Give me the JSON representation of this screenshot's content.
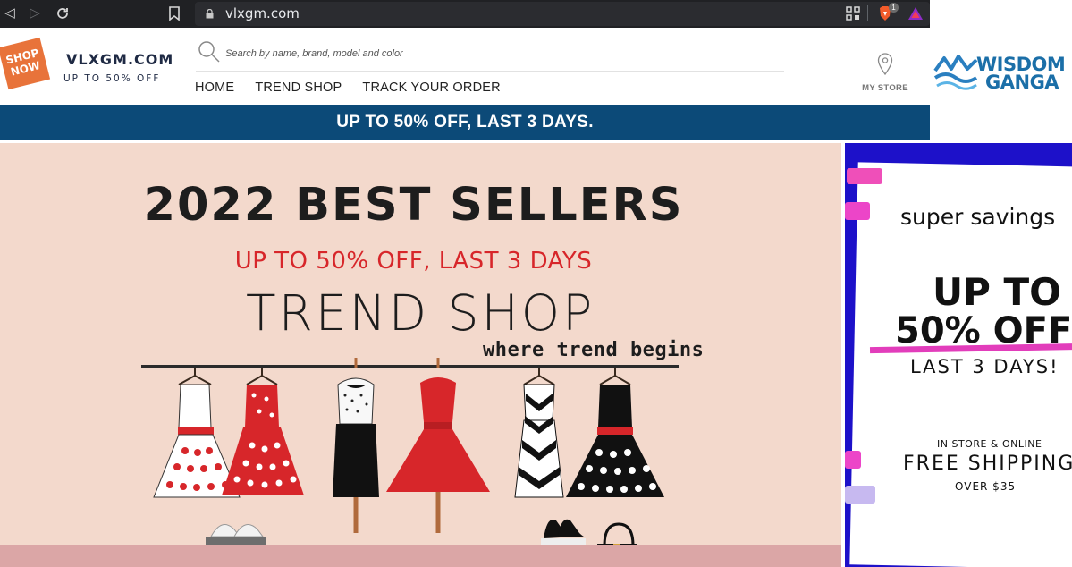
{
  "browser": {
    "url": "vlxgm.com",
    "shield_badge_count": "1",
    "icons": [
      "back-icon",
      "forward-icon",
      "reload-icon",
      "bookmark-icon",
      "lock-icon",
      "qr-icon",
      "brave-shield-icon",
      "brave-rewards-icon"
    ]
  },
  "header": {
    "shop_now_line1": "SHOP",
    "shop_now_line2": "NOW",
    "logo_title": "VLXGM.COM",
    "logo_subtitle": "UP TO 50% OFF",
    "search_placeholder": "Search by name, brand, model and color",
    "nav": [
      "HOME",
      "TREND SHOP",
      "TRACK YOUR ORDER"
    ],
    "my_store_label": "MY STORE"
  },
  "promo_bar": {
    "text": "UP TO 50% OFF, LAST 3 DAYS."
  },
  "watermark": {
    "line1": "WISDOM",
    "line2": "GANGA"
  },
  "hero": {
    "title": "2022 BEST SELLERS",
    "subtitle": "UP TO 50% OFF, LAST 3 DAYS",
    "shop_name": "TREND SHOP",
    "tagline": "where trend begins"
  },
  "side_ad": {
    "line1": "super savings",
    "line2": "UP TO",
    "line3": "50% OFF",
    "line4": "LAST 3 DAYS!",
    "line5": "IN STORE & ONLINE",
    "line6": "FREE SHIPPING",
    "line7": "OVER $35"
  },
  "colors": {
    "chrome": "#202124",
    "promo_bar": "#0c4a78",
    "hero_bg": "#f3d9cc",
    "accent_red": "#d7262a",
    "shop_now": "#e8733a",
    "side_ad_blue": "#1d11c9",
    "side_ad_pink": "#e23dbb"
  }
}
